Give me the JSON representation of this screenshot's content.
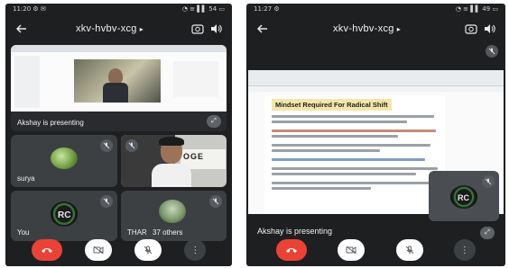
{
  "phone1": {
    "status": {
      "time": "11:20",
      "left_icons": "⚙ ✉",
      "right_icons": "◔ ≡ ▌▌ 54 ▭"
    },
    "meeting_code": "xkv-hvbv-xcg",
    "caret": "▸",
    "presenting_label": "Akshay is presenting",
    "participants": [
      {
        "name": "surya",
        "muted": true
      },
      {
        "name": "",
        "muted": false
      },
      {
        "name": "You",
        "muted": true
      },
      {
        "name": "THAR",
        "muted": false
      }
    ],
    "others_label": "37 others",
    "icons": {
      "back": "arrow-left-icon",
      "camera_switch": "camera-switch-icon",
      "audio": "speaker-icon"
    }
  },
  "phone2": {
    "status": {
      "time": "11:27",
      "left_icons": "⚙",
      "right_icons": "◔ ≡ ▌▌ 49 ▭"
    },
    "meeting_code": "xkv-hvbv-xcg",
    "caret": "▸",
    "doc_heading": "Mindset Required For Radical Shift",
    "presenting_label": "Akshay is presenting"
  },
  "colors": {
    "end_call": "#ea4335",
    "tile": "#3c4043",
    "background": "#1e1f21",
    "doc_highlight": "#f3e6a8"
  }
}
